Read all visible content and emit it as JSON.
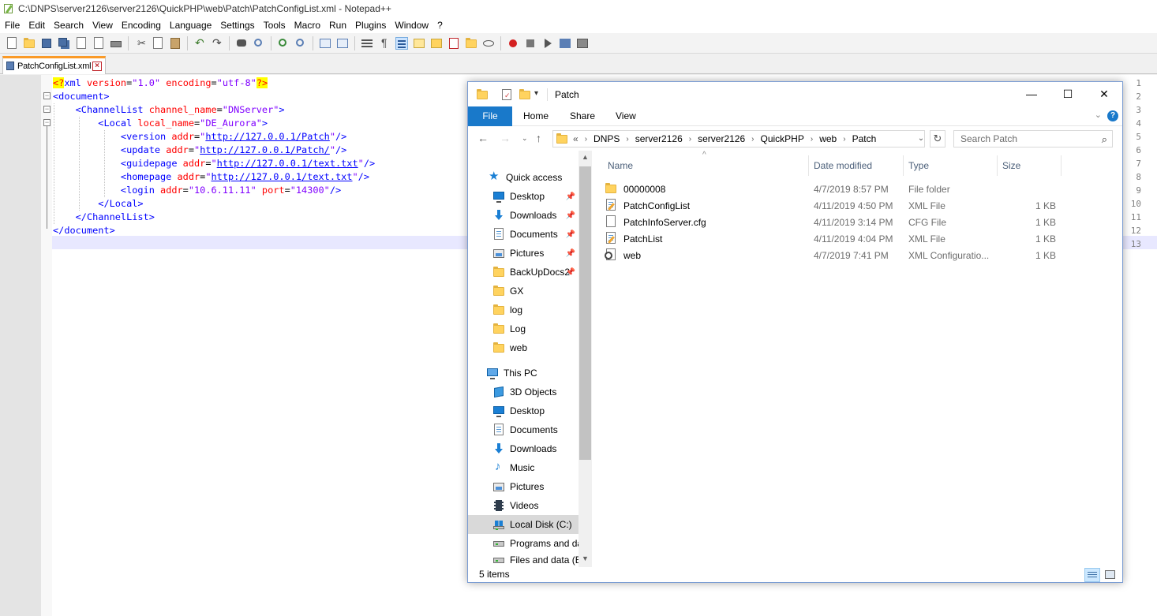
{
  "npp": {
    "title": "C:\\DNPS\\server2126\\server2126\\QuickPHP\\web\\Patch\\PatchConfigList.xml - Notepad++",
    "menu": [
      "File",
      "Edit",
      "Search",
      "View",
      "Encoding",
      "Language",
      "Settings",
      "Tools",
      "Macro",
      "Run",
      "Plugins",
      "Window",
      "?"
    ],
    "tab_label": "PatchConfigList.xml",
    "line_numbers": [
      "1",
      "2",
      "3",
      "4",
      "5",
      "6",
      "7",
      "8",
      "9",
      "10",
      "11",
      "12",
      "13"
    ]
  },
  "explorer": {
    "title": "Patch",
    "ribbon": {
      "file": "File",
      "home": "Home",
      "share": "Share",
      "view": "View"
    },
    "address": [
      "«",
      "DNPS",
      "server2126",
      "server2126",
      "QuickPHP",
      "web",
      "Patch"
    ],
    "search_placeholder": "Search Patch",
    "nav": {
      "quick_access": "Quick access",
      "qa_items": [
        "Desktop",
        "Downloads",
        "Documents",
        "Pictures",
        "BackUpDocs2",
        "GX",
        "log",
        "Log",
        "web"
      ],
      "this_pc": "This PC",
      "pc_items": [
        "3D Objects",
        "Desktop",
        "Documents",
        "Downloads",
        "Music",
        "Pictures",
        "Videos",
        "Local Disk (C:)",
        "Programs and da",
        "Files and data (E"
      ]
    },
    "columns": {
      "name": "Name",
      "date": "Date modified",
      "type": "Type",
      "size": "Size"
    },
    "files": [
      {
        "name": "00000008",
        "date": "4/7/2019 8:57 PM",
        "type": "File folder",
        "size": "",
        "icon": "folder-icon"
      },
      {
        "name": "PatchConfigList",
        "date": "4/11/2019 4:50 PM",
        "type": "XML File",
        "size": "1 KB",
        "icon": "xml-file-icon"
      },
      {
        "name": "PatchInfoServer.cfg",
        "date": "4/11/2019 3:14 PM",
        "type": "CFG File",
        "size": "1 KB",
        "icon": "file-icon"
      },
      {
        "name": "PatchList",
        "date": "4/11/2019 4:04 PM",
        "type": "XML File",
        "size": "1 KB",
        "icon": "xml-file-icon"
      },
      {
        "name": "web",
        "date": "4/7/2019 7:41 PM",
        "type": "XML Configuratio...",
        "size": "1 KB",
        "icon": "config-file-icon"
      }
    ],
    "status": "5 items"
  }
}
